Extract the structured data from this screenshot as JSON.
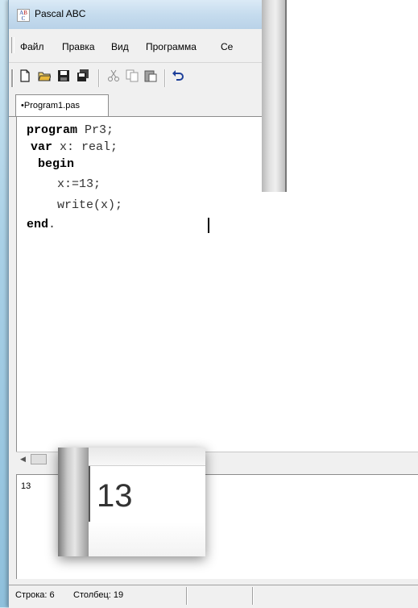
{
  "window": {
    "title": "Pascal ABC",
    "icon": "pascal-abc-icon"
  },
  "menu": [
    "Файл",
    "Правка",
    "Вид",
    "Программа",
    "Се"
  ],
  "toolbar": [
    "new-file-icon",
    "open-folder-icon",
    "save-icon",
    "save-all-icon",
    "cut-icon",
    "copy-icon",
    "paste-icon",
    "undo-icon"
  ],
  "tab": {
    "label": "•Program1.pas"
  },
  "code": {
    "line1_kw": "program",
    "line1_rest": " Pr3;",
    "line2_kw": "var",
    "line2_rest": " x: real;",
    "line3_kw": "begin",
    "line4": "x:=13;",
    "line5": "write(x);",
    "line6_kw": "end",
    "line6_rest": "."
  },
  "output": {
    "text": "13"
  },
  "zoom": {
    "text": "13"
  },
  "status": {
    "line": "Строка: 6",
    "column": "Столбец: 19"
  }
}
